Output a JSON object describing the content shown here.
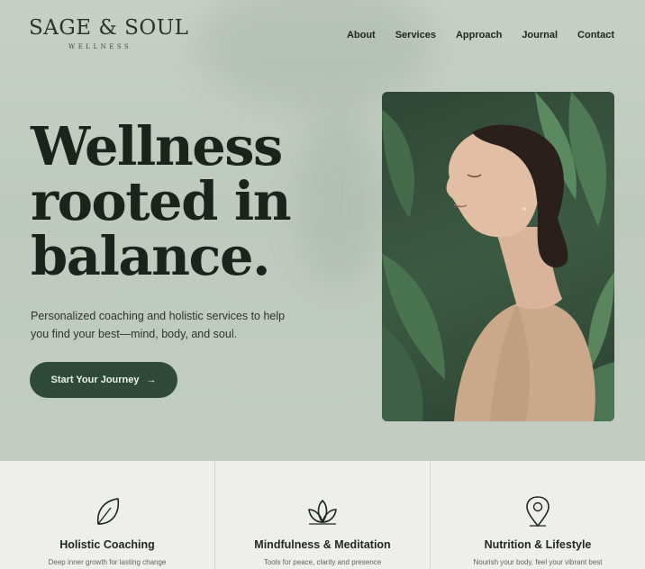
{
  "brand": {
    "name": "SAGE & SOUL",
    "tagline": "WELLNESS"
  },
  "nav": {
    "items": [
      "About",
      "Services",
      "Approach",
      "Journal",
      "Contact"
    ]
  },
  "hero": {
    "headline_lines": [
      "Wellness",
      "rooted in",
      "balance."
    ],
    "subtext_line1": "Personalized coaching and holistic services to help",
    "subtext_line2": "you find your best—mind, body, and soul.",
    "cta_label": "Start Your Journey",
    "cta_arrow": "→",
    "image_description_icon": "meditating-woman-photo"
  },
  "features": [
    {
      "icon": "leaf-icon",
      "title": "Holistic Coaching",
      "desc": "Deep inner growth for lasting change"
    },
    {
      "icon": "lotus-icon",
      "title": "Mindfulness & Meditation",
      "desc": "Tools for peace, clarity and presence"
    },
    {
      "icon": "location-pin-icon",
      "title": "Nutrition & Lifestyle",
      "desc": "Nourish your body, feel your vibrant best"
    }
  ],
  "colors": {
    "background": "#c3cdc3",
    "accent": "#2f4a3a",
    "feature_bg": "#eeefea"
  }
}
